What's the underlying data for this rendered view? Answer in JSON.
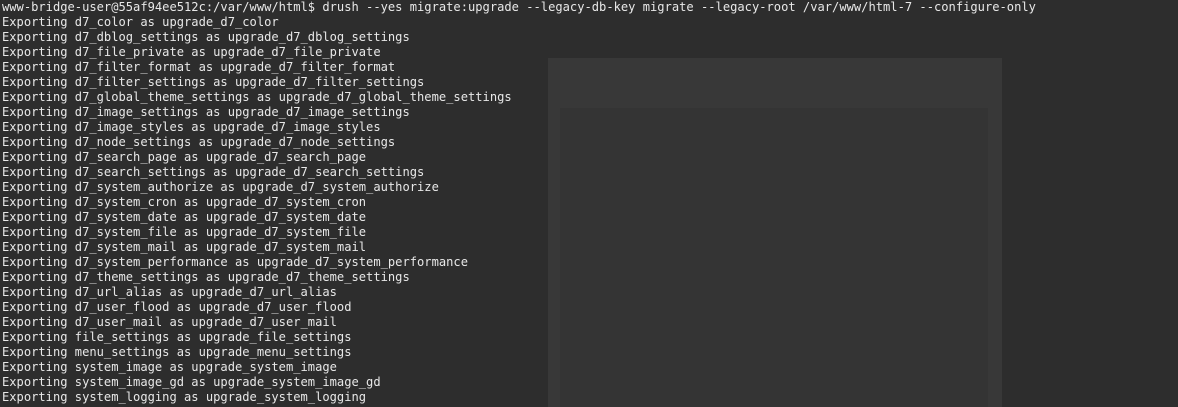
{
  "prompt_line": "www-bridge-user@55af94ee512c:/var/www/html$ drush --yes migrate:upgrade --legacy-db-key migrate --legacy-root /var/www/html-7 --configure-only",
  "output_lines": [
    "Exporting d7_color as upgrade_d7_color",
    "Exporting d7_dblog_settings as upgrade_d7_dblog_settings",
    "Exporting d7_file_private as upgrade_d7_file_private",
    "Exporting d7_filter_format as upgrade_d7_filter_format",
    "Exporting d7_filter_settings as upgrade_d7_filter_settings",
    "Exporting d7_global_theme_settings as upgrade_d7_global_theme_settings",
    "Exporting d7_image_settings as upgrade_d7_image_settings",
    "Exporting d7_image_styles as upgrade_d7_image_styles",
    "Exporting d7_node_settings as upgrade_d7_node_settings",
    "Exporting d7_search_page as upgrade_d7_search_page",
    "Exporting d7_search_settings as upgrade_d7_search_settings",
    "Exporting d7_system_authorize as upgrade_d7_system_authorize",
    "Exporting d7_system_cron as upgrade_d7_system_cron",
    "Exporting d7_system_date as upgrade_d7_system_date",
    "Exporting d7_system_file as upgrade_d7_system_file",
    "Exporting d7_system_mail as upgrade_d7_system_mail",
    "Exporting d7_system_performance as upgrade_d7_system_performance",
    "Exporting d7_theme_settings as upgrade_d7_theme_settings",
    "Exporting d7_url_alias as upgrade_d7_url_alias",
    "Exporting d7_user_flood as upgrade_d7_user_flood",
    "Exporting d7_user_mail as upgrade_d7_user_mail",
    "Exporting file_settings as upgrade_file_settings",
    "Exporting menu_settings as upgrade_menu_settings",
    "Exporting system_image as upgrade_system_image",
    "Exporting system_image_gd as upgrade_system_image_gd",
    "Exporting system_logging as upgrade_system_logging"
  ],
  "colors": {
    "background": "#2d2d2d",
    "foreground": "#e8e8e8"
  }
}
